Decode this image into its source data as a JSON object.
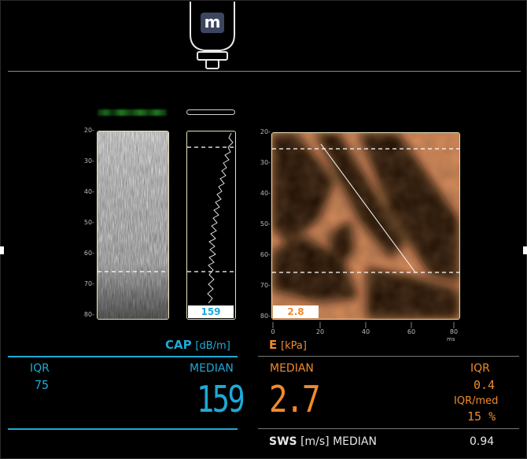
{
  "probe": {
    "logo_letter": "m"
  },
  "cap_plot": {
    "y_ticks": [
      "20",
      "30",
      "40",
      "50",
      "60",
      "70",
      "80"
    ]
  },
  "trace": {
    "badge_value": "159"
  },
  "elasto": {
    "y_ticks": [
      "20",
      "30",
      "40",
      "50",
      "60",
      "70",
      "80"
    ],
    "x_ticks": [
      "0",
      "20",
      "40",
      "60",
      "80"
    ],
    "x_unit": "ms",
    "badge_value": "2.8"
  },
  "cap": {
    "title": "CAP",
    "unit": "[dB/m]",
    "iqr_label": "IQR",
    "iqr_value": "75",
    "median_label": "MEDIAN",
    "median_value": "159"
  },
  "e": {
    "title": "E",
    "unit": "[kPa]",
    "median_label": "MEDIAN",
    "median_value": "2.7",
    "iqr_label": "IQR",
    "iqr_value": "0.4",
    "iqr_med_label": "IQR/med",
    "iqr_med_value": "15 %"
  },
  "sws": {
    "title": "SWS",
    "unit": "[m/s]",
    "median_label": "MEDIAN",
    "value": "0.94"
  },
  "colors": {
    "cyan": "#1fa9d6",
    "orange": "#f08a2c",
    "background": "#000000"
  }
}
